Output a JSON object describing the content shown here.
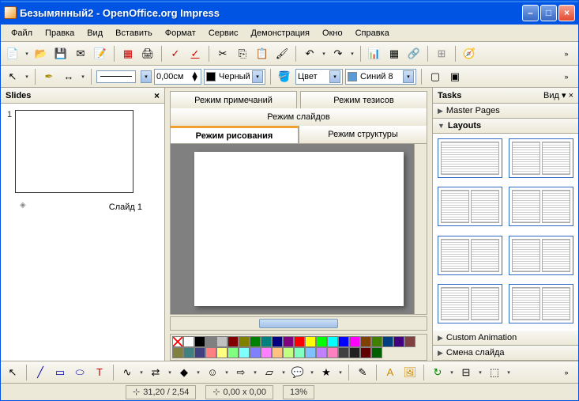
{
  "title": "Безымянный2 - OpenOffice.org Impress",
  "menu": [
    "Файл",
    "Правка",
    "Вид",
    "Вставить",
    "Формат",
    "Сервис",
    "Демонстрация",
    "Окно",
    "Справка"
  ],
  "format_bar": {
    "line_width": "0,00см",
    "line_color_label": "Черный",
    "line_color": "#000000",
    "fill_label": "Цвет",
    "scheme_label": "Синий 8",
    "scheme_color": "#5b9bd5"
  },
  "slides_panel": {
    "title": "Slides",
    "slide_number": "1",
    "slide_label": "Слайд 1"
  },
  "view_modes": {
    "notes": "Режим примечаний",
    "outline_top": "Режим тезисов",
    "slides": "Режим слайдов",
    "drawing": "Режим рисования",
    "structure": "Режим структуры"
  },
  "tasks_panel": {
    "title": "Tasks",
    "view_label": "Вид",
    "sections": {
      "master": "Master Pages",
      "layouts": "Layouts",
      "anim": "Custom Animation",
      "trans": "Смена слайда"
    }
  },
  "palette": [
    "#ffffff",
    "#000000",
    "#808080",
    "#c0c0c0",
    "#800000",
    "#808000",
    "#008000",
    "#008080",
    "#000080",
    "#800080",
    "#ff0000",
    "#ffff00",
    "#00ff00",
    "#00ffff",
    "#0000ff",
    "#ff00ff",
    "#804000",
    "#408000",
    "#004080",
    "#400080",
    "#804040",
    "#808040",
    "#408080",
    "#404080",
    "#ff8080",
    "#ffff80",
    "#80ff80",
    "#80ffff",
    "#8080ff",
    "#ff80ff",
    "#ffc080",
    "#c0ff80",
    "#80ffc0",
    "#80c0ff",
    "#c080ff",
    "#ff80c0",
    "#404040",
    "#202020",
    "#600000",
    "#006000"
  ],
  "status": {
    "pos": "31,20 / 2,54",
    "size": "0,00 x 0,00",
    "zoom": "13%"
  }
}
